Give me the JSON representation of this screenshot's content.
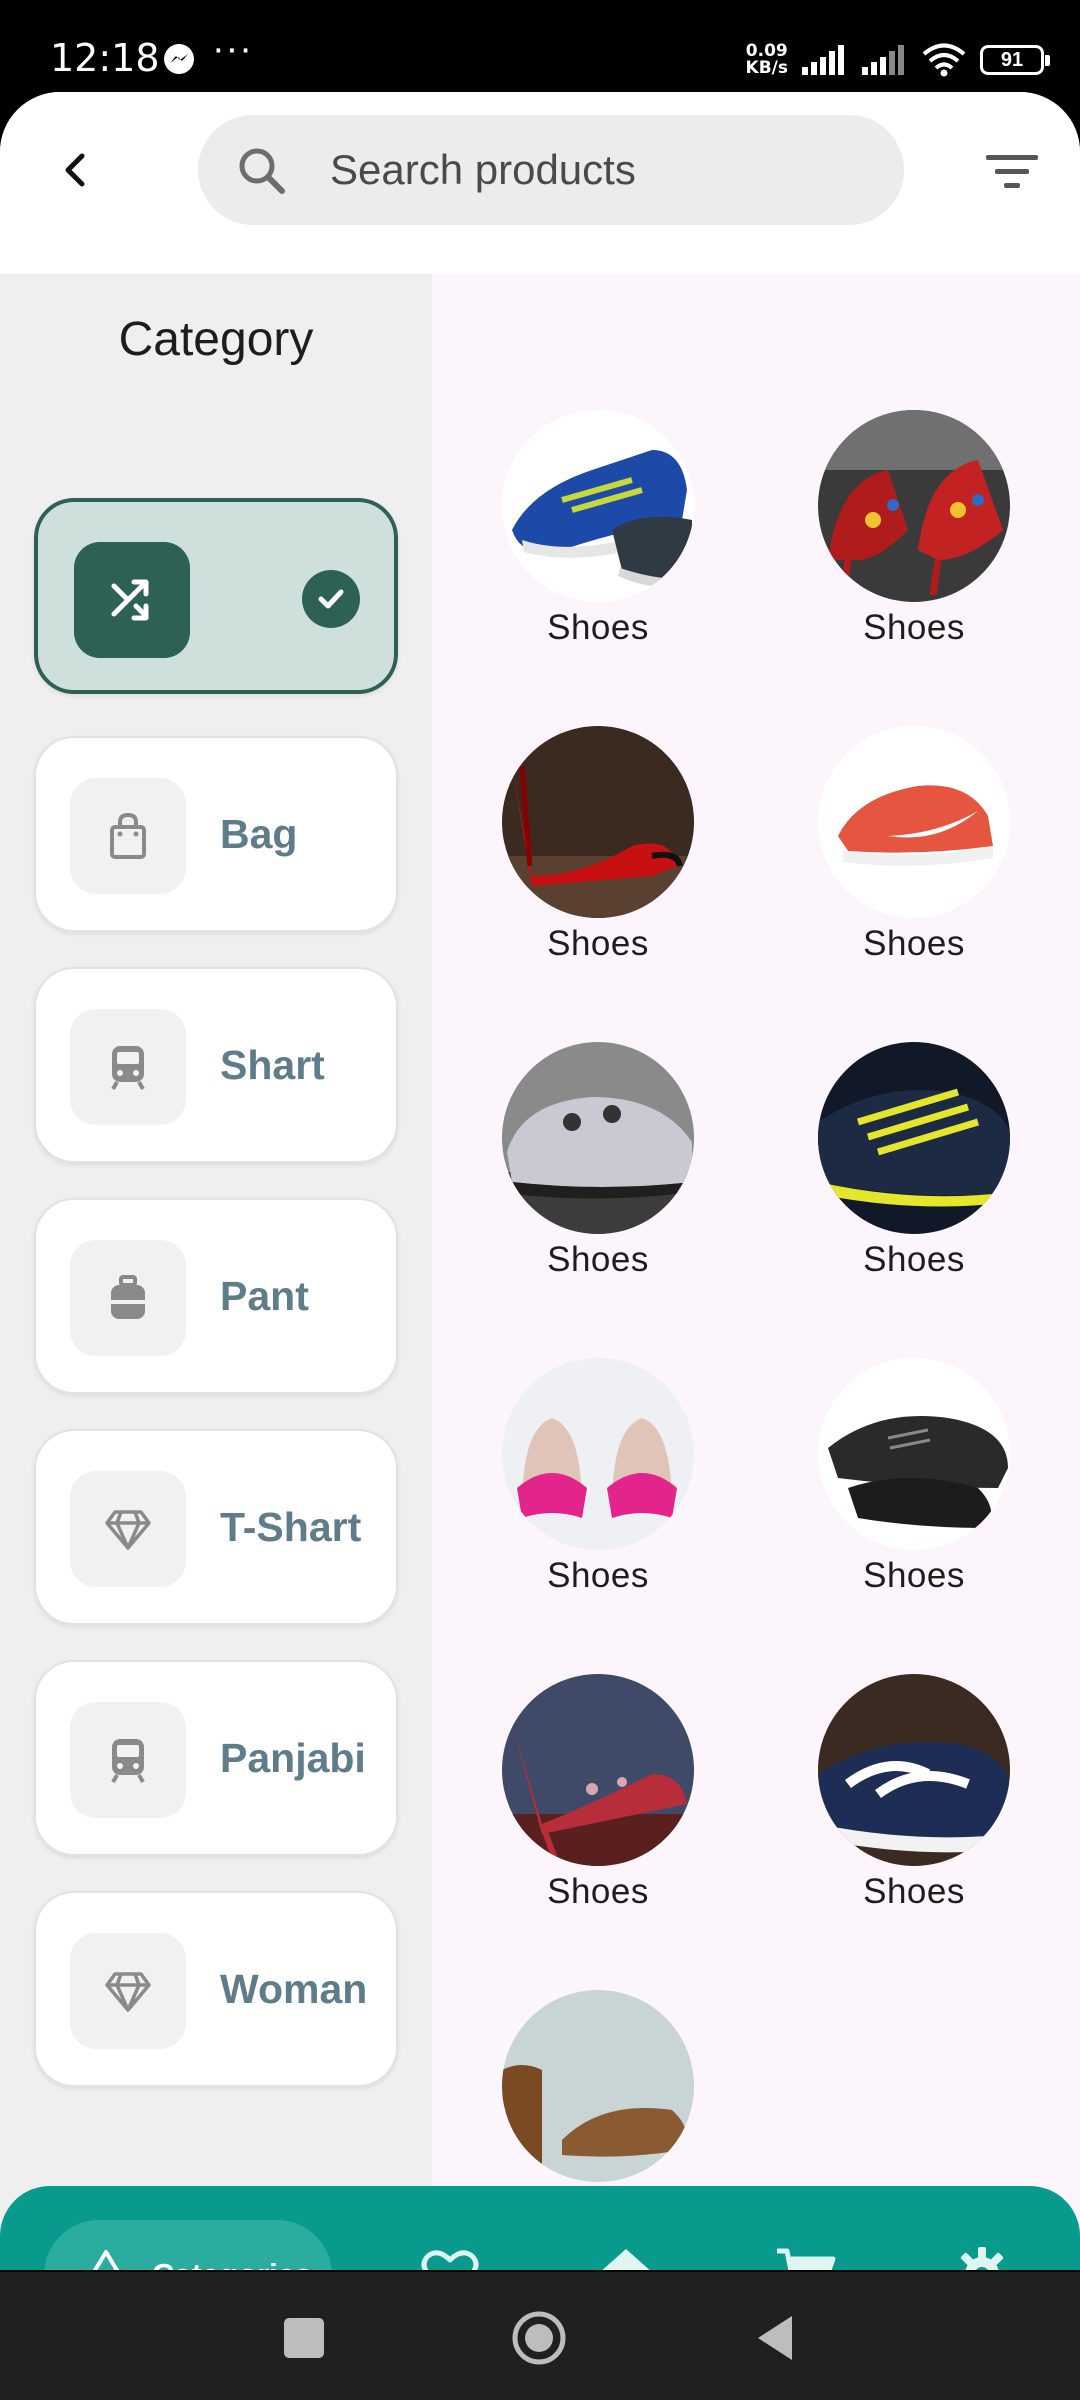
{
  "status_bar": {
    "time": "12:18",
    "more": "···",
    "net_speed_value": "0.09",
    "net_speed_unit": "KB/s",
    "battery": "91"
  },
  "header": {
    "search_placeholder": "Search products"
  },
  "categories": {
    "title": "Category",
    "items": [
      {
        "label": "",
        "icon": "shuffle-icon",
        "selected": true
      },
      {
        "label": "Bag",
        "icon": "shopping-bag-icon"
      },
      {
        "label": "Shart",
        "icon": "train-icon"
      },
      {
        "label": "Pant",
        "icon": "suitcase-icon"
      },
      {
        "label": "T-Shart",
        "icon": "diamond-icon"
      },
      {
        "label": "Panjabi",
        "icon": "train-icon"
      },
      {
        "label": "Woman",
        "icon": "diamond-icon"
      }
    ]
  },
  "products": [
    {
      "name": "Shoes",
      "image": "blue-sneakers"
    },
    {
      "name": "Shoes",
      "image": "floral-high-heels"
    },
    {
      "name": "Shoes",
      "image": "red-high-heels"
    },
    {
      "name": "Shoes",
      "image": "orange-nike-sneaker"
    },
    {
      "name": "Shoes",
      "image": "grey-cycling-shoes"
    },
    {
      "name": "Shoes",
      "image": "black-yellow-sneakers"
    },
    {
      "name": "Shoes",
      "image": "pink-bow-heels"
    },
    {
      "name": "Shoes",
      "image": "black-leather-shoes"
    },
    {
      "name": "Shoes",
      "image": "red-patterned-heels"
    },
    {
      "name": "Shoes",
      "image": "navy-white-sneakers"
    },
    {
      "name": "",
      "image": "brown-worn-shoes"
    }
  ],
  "bottom_nav": {
    "active_label": "Categories",
    "items": [
      "categories-icon",
      "heart-icon",
      "home-icon",
      "cart-icon",
      "gear-icon"
    ]
  },
  "colors": {
    "accent": "#089a8c",
    "selected_dark": "#2e6155",
    "category_text": "#5f7c8a"
  }
}
